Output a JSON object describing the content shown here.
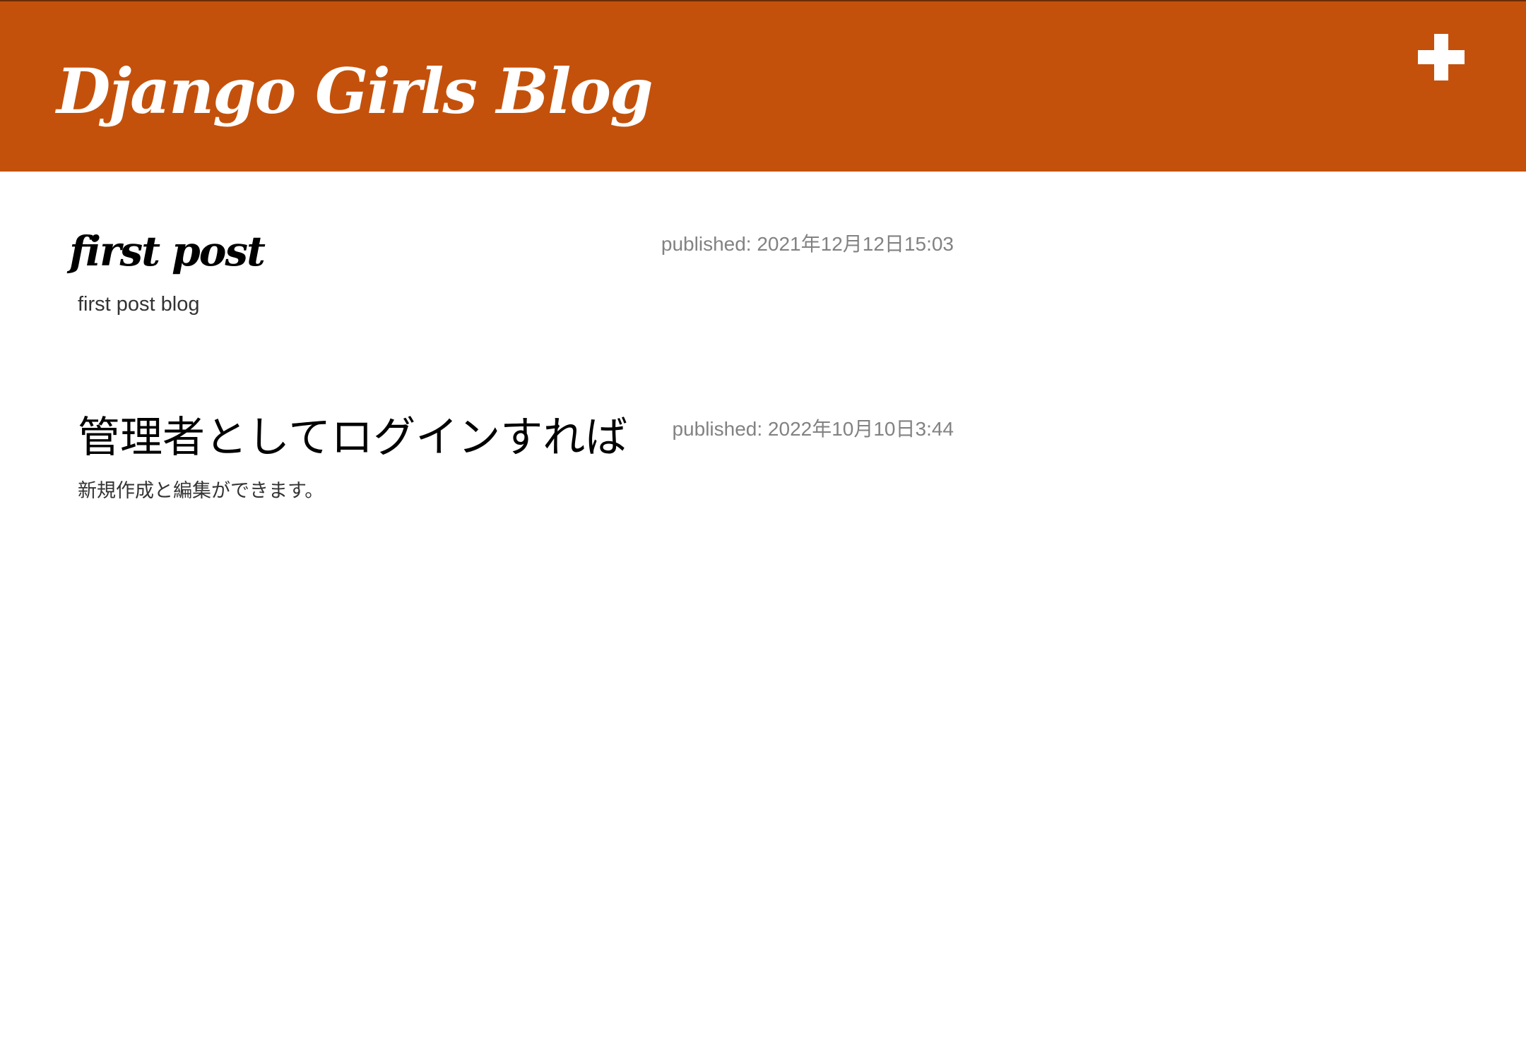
{
  "header": {
    "title": "Django Girls Blog",
    "new_post_icon": "plus-icon",
    "color": "#c4510b"
  },
  "posts": [
    {
      "date": "published: 2021年12月12日15:03",
      "title": "first post",
      "text": "first post blog"
    },
    {
      "date": "published: 2022年10月10日3:44",
      "title": "管理者としてログインすれば",
      "text": "新規作成と編集ができます。"
    }
  ]
}
